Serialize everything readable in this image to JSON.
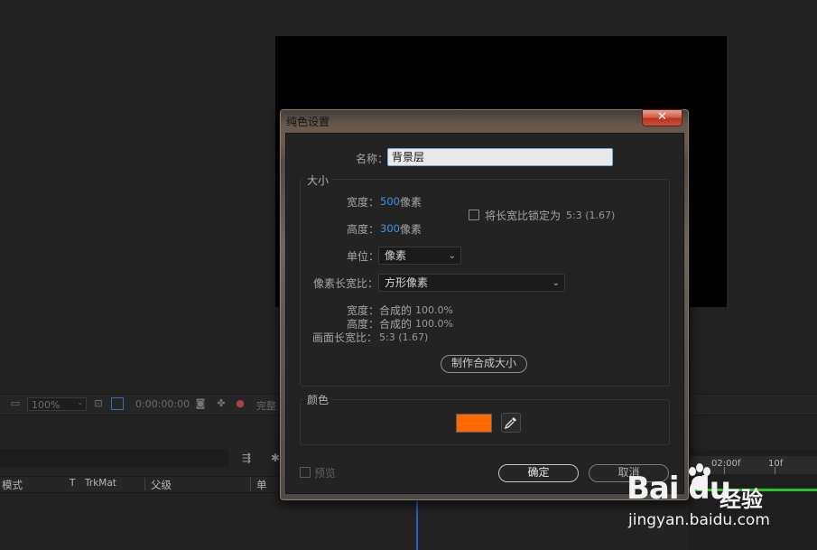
{
  "background": {
    "toolbar": {
      "zoom": "100%",
      "timecode": "0:00:00:00",
      "quality": "完整"
    },
    "timeline": {
      "headers": [
        "模式",
        "T",
        "TrkMat",
        "父级",
        "单"
      ],
      "ruler": [
        "02:00f",
        "10f"
      ]
    }
  },
  "dialog": {
    "title": "纯色设置",
    "close_glyph": "✕",
    "name_label": "名称：",
    "name_value": "背景层",
    "size_group": {
      "title": "大小",
      "width_label": "宽度：",
      "width_value": "500",
      "width_unit": "像素",
      "height_label": "高度：",
      "height_value": "300",
      "height_unit": "像素",
      "lock_label": "将长宽比锁定为",
      "lock_ratio": "5:3 (1.67)",
      "lock_checked": false,
      "unit_label": "单位：",
      "unit_value": "像素",
      "pixel_aspect_label": "像素长宽比：",
      "pixel_aspect_value": "方形像素",
      "info_width_label": "宽度：",
      "info_width_value": "合成的",
      "info_width_pct": "100.0%",
      "info_height_label": "高度：",
      "info_height_value": "合成的",
      "info_height_pct": "100.0%",
      "frame_aspect_label": "画面长宽比：",
      "frame_aspect_value": "5:3 (1.67)",
      "make_comp_size": "制作合成大小"
    },
    "color_group": {
      "title": "颜色",
      "swatch": "#ff6a00"
    },
    "preview_label": "预览",
    "ok_label": "确定",
    "cancel_label": "取消"
  },
  "watermark": {
    "brand": "Bai du",
    "sub": "经验",
    "url": "jingyan.baidu.com"
  }
}
